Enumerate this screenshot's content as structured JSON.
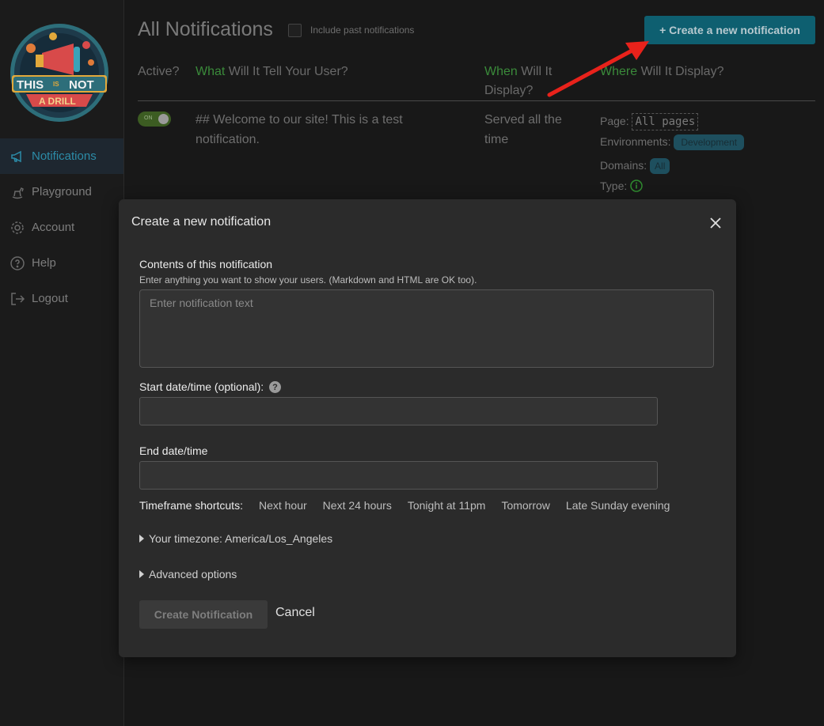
{
  "logo": {
    "line1": "THIS",
    "line_is": "IS",
    "line2": "NOT",
    "line3": "A DRILL"
  },
  "sidebar": {
    "items": [
      {
        "label": "Notifications",
        "icon": "megaphone-icon",
        "active": true
      },
      {
        "label": "Playground",
        "icon": "rocking-horse-icon",
        "active": false
      },
      {
        "label": "Account",
        "icon": "gear-icon",
        "active": false
      },
      {
        "label": "Help",
        "icon": "question-circle-icon",
        "active": false
      },
      {
        "label": "Logout",
        "icon": "logout-icon",
        "active": false
      }
    ]
  },
  "header": {
    "title": "All Notifications",
    "include_past_label": "Include past notifications",
    "create_button": "+ Create a new notification"
  },
  "table": {
    "col_active": "Active?",
    "col_what_hl": "What",
    "col_what_rest": " Will It Tell Your User?",
    "col_when_hl": "When",
    "col_when_rest": " Will It Display?",
    "col_where_hl": "Where",
    "col_where_rest": " Will It Display?",
    "row": {
      "toggle_label": "ON",
      "what": "## Welcome to our site! This is a test notification.",
      "when": "Served all the time",
      "page_label": "Page:",
      "page_value": "All pages",
      "env_label": "Environments:",
      "env_value": "Development",
      "domains_label": "Domains:",
      "domains_value": "All",
      "type_label": "Type:"
    }
  },
  "modal": {
    "title": "Create a new notification",
    "contents_label": "Contents of this notification",
    "contents_hint": "Enter anything you want to show your users. (Markdown and HTML are OK too).",
    "contents_placeholder": "Enter notification text",
    "contents_value": "",
    "start_label": "Start date/time (optional):",
    "start_value": "",
    "end_label": "End date/time",
    "end_value": "",
    "shortcuts_label": "Timeframe shortcuts:",
    "shortcuts": [
      "Next hour",
      "Next 24 hours",
      "Tonight at 11pm",
      "Tomorrow",
      "Late Sunday evening"
    ],
    "timezone": "Your timezone: America/Los_Angeles",
    "advanced": "Advanced options",
    "submit": "Create Notification",
    "cancel": "Cancel"
  },
  "colors": {
    "accent": "#0e5f70",
    "active_nav": "#2c8ca8",
    "highlight_green": "#3a8a3a",
    "arrow": "#e8221b"
  }
}
